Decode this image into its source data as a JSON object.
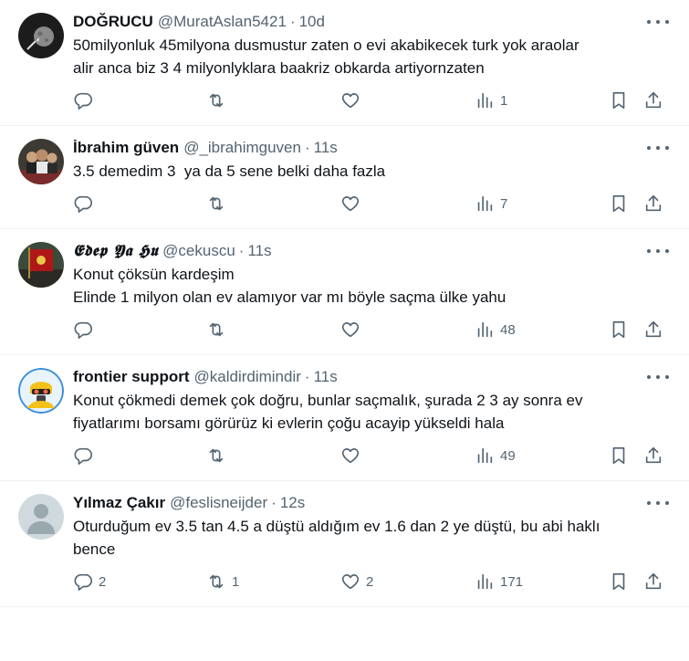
{
  "tweets": [
    {
      "name": "DOĞRUCU",
      "handle": "@MuratAslan5421",
      "separator": "·",
      "time": "10d",
      "lines": [
        "50milyonluk 45milyona dusmustur zaten o evi akabikecek turk yok araolar",
        "alir anca biz 3 4 milyonlyklara baakriz obkarda artiyornzaten"
      ],
      "replies": "",
      "retweets": "",
      "likes": "",
      "views": "1",
      "avatar": "moon-rocket-avatar",
      "name_style": "plain"
    },
    {
      "name": "İbrahim güven",
      "handle": "@_ibrahimguven",
      "separator": "·",
      "time": "11s",
      "lines": [
        "3.5 demedim 3  ya da 5 sene belki daha fazla"
      ],
      "replies": "",
      "retweets": "",
      "likes": "",
      "views": "7",
      "avatar": "group-photo-avatar",
      "name_style": "plain"
    },
    {
      "name": "𝕰𝖉𝖊𝖕 𝖄𝖆 𝕳𝖚",
      "handle": "@cekuscu",
      "separator": "·",
      "time": "11s",
      "lines": [
        "Konut çöksün kardeşim",
        "Elinde 1 milyon olan ev alamıyor var mı böyle saçma ülke yahu"
      ],
      "replies": "",
      "retweets": "",
      "likes": "",
      "views": "48",
      "avatar": "red-flag-avatar",
      "name_style": "fancy"
    },
    {
      "name": "frontier support",
      "handle": "@kaldirdimindir",
      "separator": "·",
      "time": "11s",
      "lines": [
        "Konut çökmedi demek çok doğru, bunlar saçmalık, şurada 2 3 ay sonra ev",
        "fiyatlarımı borsamı görürüz ki evlerin çoğu acayip yükseldi hala"
      ],
      "replies": "",
      "retweets": "",
      "likes": "",
      "views": "49",
      "avatar": "gasmask-avatar",
      "name_style": "plain"
    },
    {
      "name": "Yılmaz Çakır",
      "handle": "@feslisneijder",
      "separator": "·",
      "time": "12s",
      "lines": [
        "Oturduğum ev 3.5 tan 4.5 a düştü aldığım ev 1.6 dan 2 ye düştü, bu abi haklı",
        "bence"
      ],
      "replies": "2",
      "retweets": "1",
      "likes": "2",
      "views": "171",
      "avatar": "default-user-avatar",
      "name_style": "plain"
    }
  ],
  "icons": {
    "reply": "reply-icon",
    "retweet": "retweet-icon",
    "like": "heart-icon",
    "views": "views-icon",
    "bookmark": "bookmark-icon",
    "share": "share-icon",
    "more": "more-options-icon"
  },
  "colors": {
    "text": "#0f1419",
    "secondary": "#536471",
    "divider": "#eff3f4"
  }
}
